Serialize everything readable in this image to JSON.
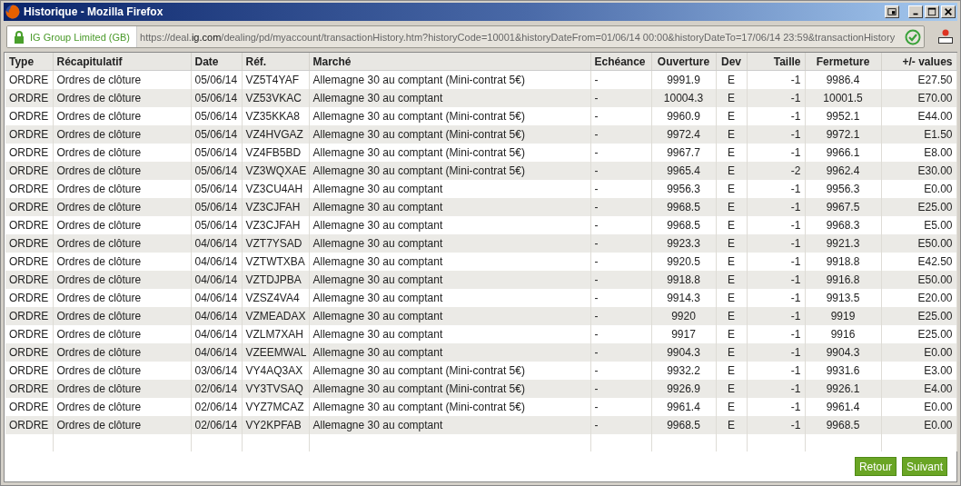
{
  "window": {
    "title": "Historique - Mozilla Firefox"
  },
  "address_bar": {
    "identity": "IG Group Limited (GB)",
    "url_prefix": "https://deal.",
    "url_domain": "ig.com",
    "url_rest": "/dealing/pd/myaccount/transactionHistory.htm?historyCode=10001&historyDateFrom=01/06/14 00:00&historyDateTo=17/06/14 23:59&transactionHistory"
  },
  "table": {
    "columns": [
      "Type",
      "Récapitulatif",
      "Date",
      "Réf.",
      "Marché",
      "Echéance",
      "Ouverture",
      "Dev",
      "Taille",
      "Fermeture",
      "+/- values"
    ],
    "rows": [
      [
        "ORDRE",
        "Ordres de clôture",
        "05/06/14",
        "VZ5T4YAF",
        "Allemagne 30 au comptant (Mini-contrat 5€)",
        "-",
        "9991.9",
        "E",
        "-1",
        "9986.4",
        "E27.50"
      ],
      [
        "ORDRE",
        "Ordres de clôture",
        "05/06/14",
        "VZ53VKAC",
        "Allemagne 30 au comptant",
        "-",
        "10004.3",
        "E",
        "-1",
        "10001.5",
        "E70.00"
      ],
      [
        "ORDRE",
        "Ordres de clôture",
        "05/06/14",
        "VZ35KKA8",
        "Allemagne 30 au comptant (Mini-contrat 5€)",
        "-",
        "9960.9",
        "E",
        "-1",
        "9952.1",
        "E44.00"
      ],
      [
        "ORDRE",
        "Ordres de clôture",
        "05/06/14",
        "VZ4HVGAZ",
        "Allemagne 30 au comptant (Mini-contrat 5€)",
        "-",
        "9972.4",
        "E",
        "-1",
        "9972.1",
        "E1.50"
      ],
      [
        "ORDRE",
        "Ordres de clôture",
        "05/06/14",
        "VZ4FB5BD",
        "Allemagne 30 au comptant (Mini-contrat 5€)",
        "-",
        "9967.7",
        "E",
        "-1",
        "9966.1",
        "E8.00"
      ],
      [
        "ORDRE",
        "Ordres de clôture",
        "05/06/14",
        "VZ3WQXAE",
        "Allemagne 30 au comptant (Mini-contrat 5€)",
        "-",
        "9965.4",
        "E",
        "-2",
        "9962.4",
        "E30.00"
      ],
      [
        "ORDRE",
        "Ordres de clôture",
        "05/06/14",
        "VZ3CU4AH",
        "Allemagne 30 au comptant",
        "-",
        "9956.3",
        "E",
        "-1",
        "9956.3",
        "E0.00"
      ],
      [
        "ORDRE",
        "Ordres de clôture",
        "05/06/14",
        "VZ3CJFAH",
        "Allemagne 30 au comptant",
        "-",
        "9968.5",
        "E",
        "-1",
        "9967.5",
        "E25.00"
      ],
      [
        "ORDRE",
        "Ordres de clôture",
        "05/06/14",
        "VZ3CJFAH",
        "Allemagne 30 au comptant",
        "-",
        "9968.5",
        "E",
        "-1",
        "9968.3",
        "E5.00"
      ],
      [
        "ORDRE",
        "Ordres de clôture",
        "04/06/14",
        "VZT7YSAD",
        "Allemagne 30 au comptant",
        "-",
        "9923.3",
        "E",
        "-1",
        "9921.3",
        "E50.00"
      ],
      [
        "ORDRE",
        "Ordres de clôture",
        "04/06/14",
        "VZTWTXBA",
        "Allemagne 30 au comptant",
        "-",
        "9920.5",
        "E",
        "-1",
        "9918.8",
        "E42.50"
      ],
      [
        "ORDRE",
        "Ordres de clôture",
        "04/06/14",
        "VZTDJPBA",
        "Allemagne 30 au comptant",
        "-",
        "9918.8",
        "E",
        "-1",
        "9916.8",
        "E50.00"
      ],
      [
        "ORDRE",
        "Ordres de clôture",
        "04/06/14",
        "VZSZ4VA4",
        "Allemagne 30 au comptant",
        "-",
        "9914.3",
        "E",
        "-1",
        "9913.5",
        "E20.00"
      ],
      [
        "ORDRE",
        "Ordres de clôture",
        "04/06/14",
        "VZMEADAX",
        "Allemagne 30 au comptant",
        "-",
        "9920",
        "E",
        "-1",
        "9919",
        "E25.00"
      ],
      [
        "ORDRE",
        "Ordres de clôture",
        "04/06/14",
        "VZLM7XAH",
        "Allemagne 30 au comptant",
        "-",
        "9917",
        "E",
        "-1",
        "9916",
        "E25.00"
      ],
      [
        "ORDRE",
        "Ordres de clôture",
        "04/06/14",
        "VZEEMWAL",
        "Allemagne 30 au comptant",
        "-",
        "9904.3",
        "E",
        "-1",
        "9904.3",
        "E0.00"
      ],
      [
        "ORDRE",
        "Ordres de clôture",
        "03/06/14",
        "VY4AQ3AX",
        "Allemagne 30 au comptant (Mini-contrat 5€)",
        "-",
        "9932.2",
        "E",
        "-1",
        "9931.6",
        "E3.00"
      ],
      [
        "ORDRE",
        "Ordres de clôture",
        "02/06/14",
        "VY3TVSAQ",
        "Allemagne 30 au comptant (Mini-contrat 5€)",
        "-",
        "9926.9",
        "E",
        "-1",
        "9926.1",
        "E4.00"
      ],
      [
        "ORDRE",
        "Ordres de clôture",
        "02/06/14",
        "VYZ7MCAZ",
        "Allemagne 30 au comptant (Mini-contrat 5€)",
        "-",
        "9961.4",
        "E",
        "-1",
        "9961.4",
        "E0.00"
      ],
      [
        "ORDRE",
        "Ordres de clôture",
        "02/06/14",
        "VY2KPFAB",
        "Allemagne 30 au comptant",
        "-",
        "9968.5",
        "E",
        "-1",
        "9968.5",
        "E0.00"
      ]
    ]
  },
  "buttons": [
    "Retour",
    "Suivant"
  ]
}
